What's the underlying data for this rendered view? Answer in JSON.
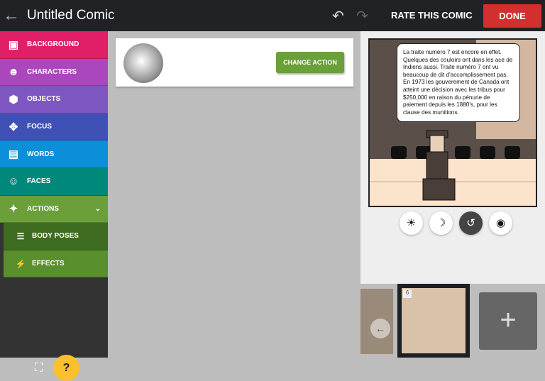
{
  "header": {
    "title": "Untitled Comic",
    "rate_label": "RATE THIS COMIC",
    "done_label": "DONE"
  },
  "sidebar": {
    "items": [
      {
        "label": "BACKGROUND",
        "color": "#e01f68"
      },
      {
        "label": "CHARACTERS",
        "color": "#ab47bc"
      },
      {
        "label": "OBJECTS",
        "color": "#7e57c2"
      },
      {
        "label": "FOCUS",
        "color": "#3f51b5"
      },
      {
        "label": "WORDS",
        "color": "#0b8fd8"
      },
      {
        "label": "FACES",
        "color": "#00897b"
      },
      {
        "label": "ACTIONS",
        "color": "#6a9f3a"
      }
    ],
    "subitems": [
      {
        "label": "BODY POSES"
      },
      {
        "label": "EFFECTS"
      }
    ],
    "help_label": "?"
  },
  "editor": {
    "change_action_label": "CHANGE ACTION"
  },
  "panel": {
    "bubble_text": "La traite numéro 7 est encore en effet. Quelques des couloirs ont dans les ace de Indiens aussi. Traite numéro 7 ont vu beaucoup de dit d'accomplissement pas. En 1973 les gouverement de Canada ont atteint une décision avec les tribus pour $250,000 en raison du pénurie de paiement depuis les 1880's, pour les clause des munitions."
  },
  "strip": {
    "current_number": "6",
    "add_label": "+"
  }
}
